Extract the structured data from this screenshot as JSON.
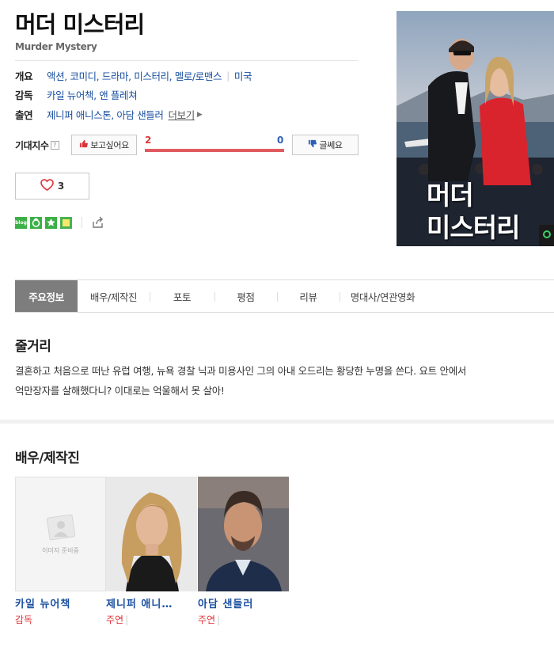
{
  "movie": {
    "title": "머더 미스터리",
    "original_title": "Murder Mystery"
  },
  "info": {
    "overview_label": "개요",
    "genres": "액션, 코미디, 드라마, 미스터리, 멜로/로맨스",
    "country": "미국",
    "director_label": "감독",
    "directors": "카일 뉴어책, 앤 플레쳐",
    "cast_label": "출연",
    "cast": "제니퍼 애니스톤, 아담 샌들러",
    "more_label": "더보기"
  },
  "expectation": {
    "label": "기대지수",
    "help": "?",
    "want_label": "보고싶어요",
    "meh_label": "글쎄요",
    "want_count": "2",
    "meh_count": "0",
    "want_ratio": 1.0
  },
  "like": {
    "count": "3"
  },
  "share": {
    "icons": [
      "blog-icon",
      "band-icon",
      "favorite-star-icon",
      "memo-icon"
    ],
    "blog_text": "blog"
  },
  "poster": {
    "title_line1": "머더",
    "title_line2": "미스터리"
  },
  "tabs": [
    {
      "label": "주요정보",
      "active": true
    },
    {
      "label": "배우/제작진"
    },
    {
      "label": "포토"
    },
    {
      "label": "평점"
    },
    {
      "label": "리뷰"
    },
    {
      "label": "명대사/연관영화"
    }
  ],
  "synopsis": {
    "heading": "줄거리",
    "line1": "결혼하고 처음으로 떠난 유럽 여행, 뉴욕 경찰 닉과 미용사인 그의 아내 오드리는 황당한 누명을 쓴다. 요트 안에서",
    "line2": "억만장자를 살해했다니? 이대로는 억울해서 못 살아!"
  },
  "crew": {
    "heading": "배우/제작진",
    "placeholder_text": "이미지 준비중",
    "people": [
      {
        "name": "카일 뉴어책",
        "role": "감독"
      },
      {
        "name": "제니퍼 애니…",
        "role": "주연"
      },
      {
        "name": "아담 샌들러",
        "role": "주연"
      }
    ]
  },
  "colors": {
    "link": "#1a4fa0",
    "accent_red": "#e0383d",
    "accent_blue": "#2c5fb8",
    "tab_active_bg": "#7d7d7d"
  }
}
